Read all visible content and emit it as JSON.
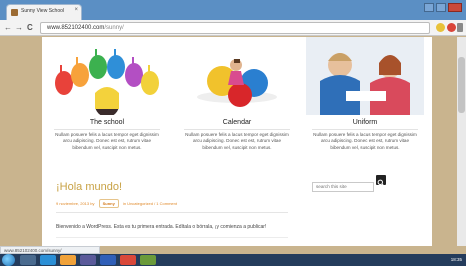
{
  "browser": {
    "tab_title": "Sunny View School",
    "url_host": "www.8521024",
    "url_rest": "00.com",
    "url_path": "/sunny/",
    "nav_back": "←",
    "nav_forward": "→",
    "nav_reload": "C",
    "close_label": "×"
  },
  "features": [
    {
      "heading": "The school",
      "text": "Nullam posuere felis a lacus tempor eget dignissim arcu adipiscing. Donec est est, rutrum vitae bibendum vel, suscipit non metus."
    },
    {
      "heading": "Calendar",
      "text": "Nullam posuere felis a lacus tempor eget dignissim arcu adipiscing. Donec est est, rutrum vitae bibendum vel, suscipit non metus."
    },
    {
      "heading": "Uniform",
      "text": "Nullam posuere felis a lacus tempor eget dignissim arcu adipiscing. Donec est est, rutrum vitae bibendum vel, suscipit non metus."
    }
  ],
  "post": {
    "title": "¡Hola mundo!",
    "date": "9 noviembre, 2013 by",
    "author": "Sunny",
    "category": "in Uncategorized / 1 Comment",
    "body": "Bienvenido a WordPress. Esta es tu primera entrada. Edítala o bórrala, ¡y comienza a publicar!"
  },
  "search": {
    "placeholder": "search this site"
  },
  "status": {
    "text": "www.852102400.com/sunny/"
  },
  "taskbar": {
    "clock": "18:35"
  },
  "colors": {
    "title_bar": "#5b8fc4",
    "accent_orange": "#e08a2b",
    "post_title": "#c8a245"
  }
}
